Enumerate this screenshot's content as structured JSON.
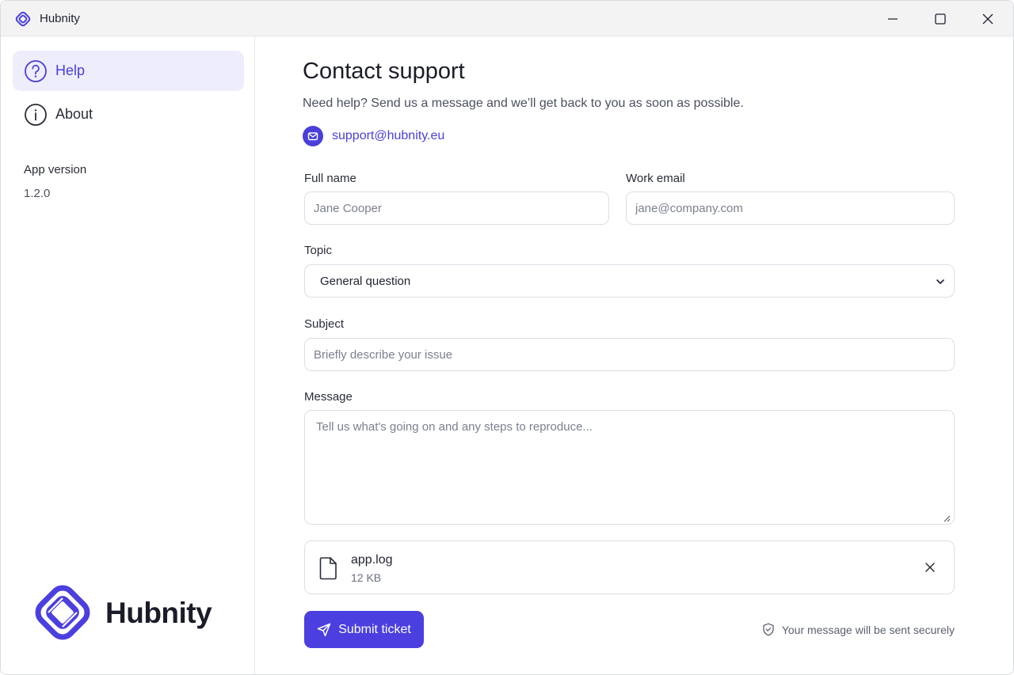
{
  "window": {
    "title": "Hubnity"
  },
  "sidebar": {
    "items": [
      {
        "label": "Help",
        "icon": "help-circle-icon",
        "active": true
      },
      {
        "label": "About",
        "icon": "info-circle-icon",
        "active": false
      }
    ],
    "version_label": "App version",
    "version_value": "1.2.0",
    "brand_name": "Hubnity"
  },
  "main": {
    "title": "Contact support",
    "subtitle": "Need help? Send us a message and we’ll get back to you as soon as possible.",
    "support_email": "support@hubnity.eu",
    "form": {
      "full_name": {
        "label": "Full name",
        "placeholder": "Jane Cooper",
        "value": ""
      },
      "work_email": {
        "label": "Work email",
        "placeholder": "jane@company.com",
        "value": ""
      },
      "topic": {
        "label": "Topic",
        "selected": "General question"
      },
      "subject": {
        "label": "Subject",
        "placeholder": "Briefly describe your issue",
        "value": ""
      },
      "message": {
        "label": "Message",
        "placeholder": "Tell us what's going on and any steps to reproduce...",
        "value": ""
      }
    },
    "attachment": {
      "name": "app.log",
      "size": "12 KB"
    },
    "submit_label": "Submit ticket",
    "secure_note": "Your message will be sent securely"
  },
  "colors": {
    "accent": "#4b3fe0",
    "active_nav_bg": "#eeedfb",
    "border": "#dcdee5"
  }
}
